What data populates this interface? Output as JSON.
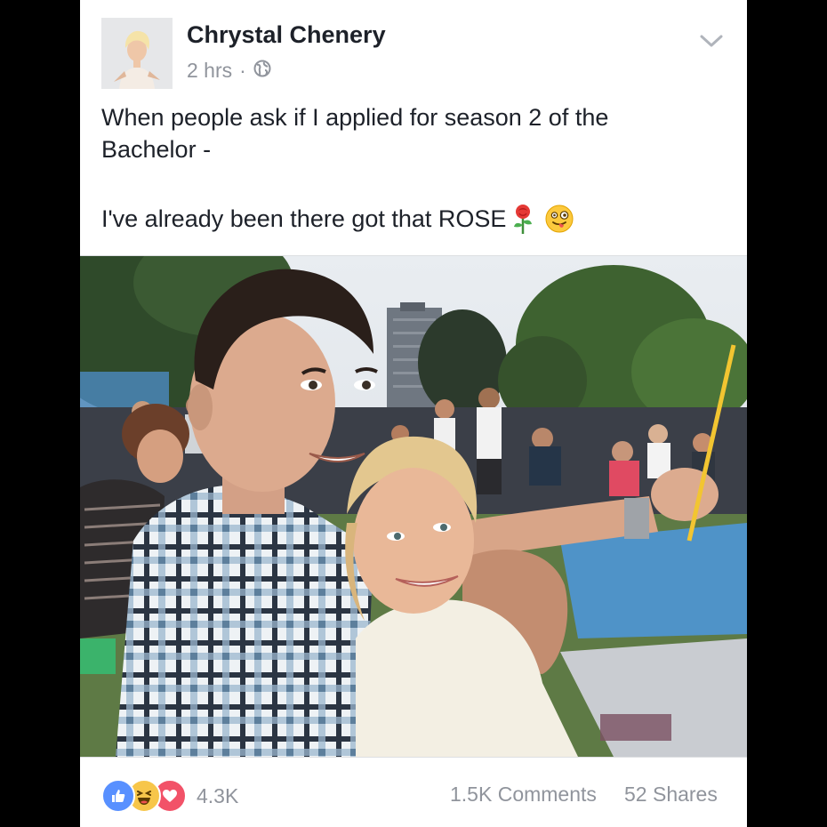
{
  "post": {
    "author": "Chrystal Chenery",
    "time": "2 hrs",
    "separator": "·",
    "privacy_icon": "globe-icon",
    "menu_icon": "chevron-down-icon",
    "text_line1": "When people ask if I applied for season 2 of the",
    "text_line2": "Bachelor -",
    "text_line3": "I've already been there got that ROSE",
    "emojis": [
      "rose-emoji",
      "winking-tongue-emoji"
    ]
  },
  "footer": {
    "reaction_icons": [
      "like-icon",
      "haha-icon",
      "love-icon"
    ],
    "reaction_count": "4.3K",
    "comments": "1.5K Comments",
    "shares": "52 Shares"
  },
  "colors": {
    "background": "#000000",
    "card": "#ffffff",
    "text": "#1d2129",
    "secondary": "#90949c",
    "like": "#5890ff",
    "haha": "#f7c64a",
    "love": "#f25268"
  }
}
